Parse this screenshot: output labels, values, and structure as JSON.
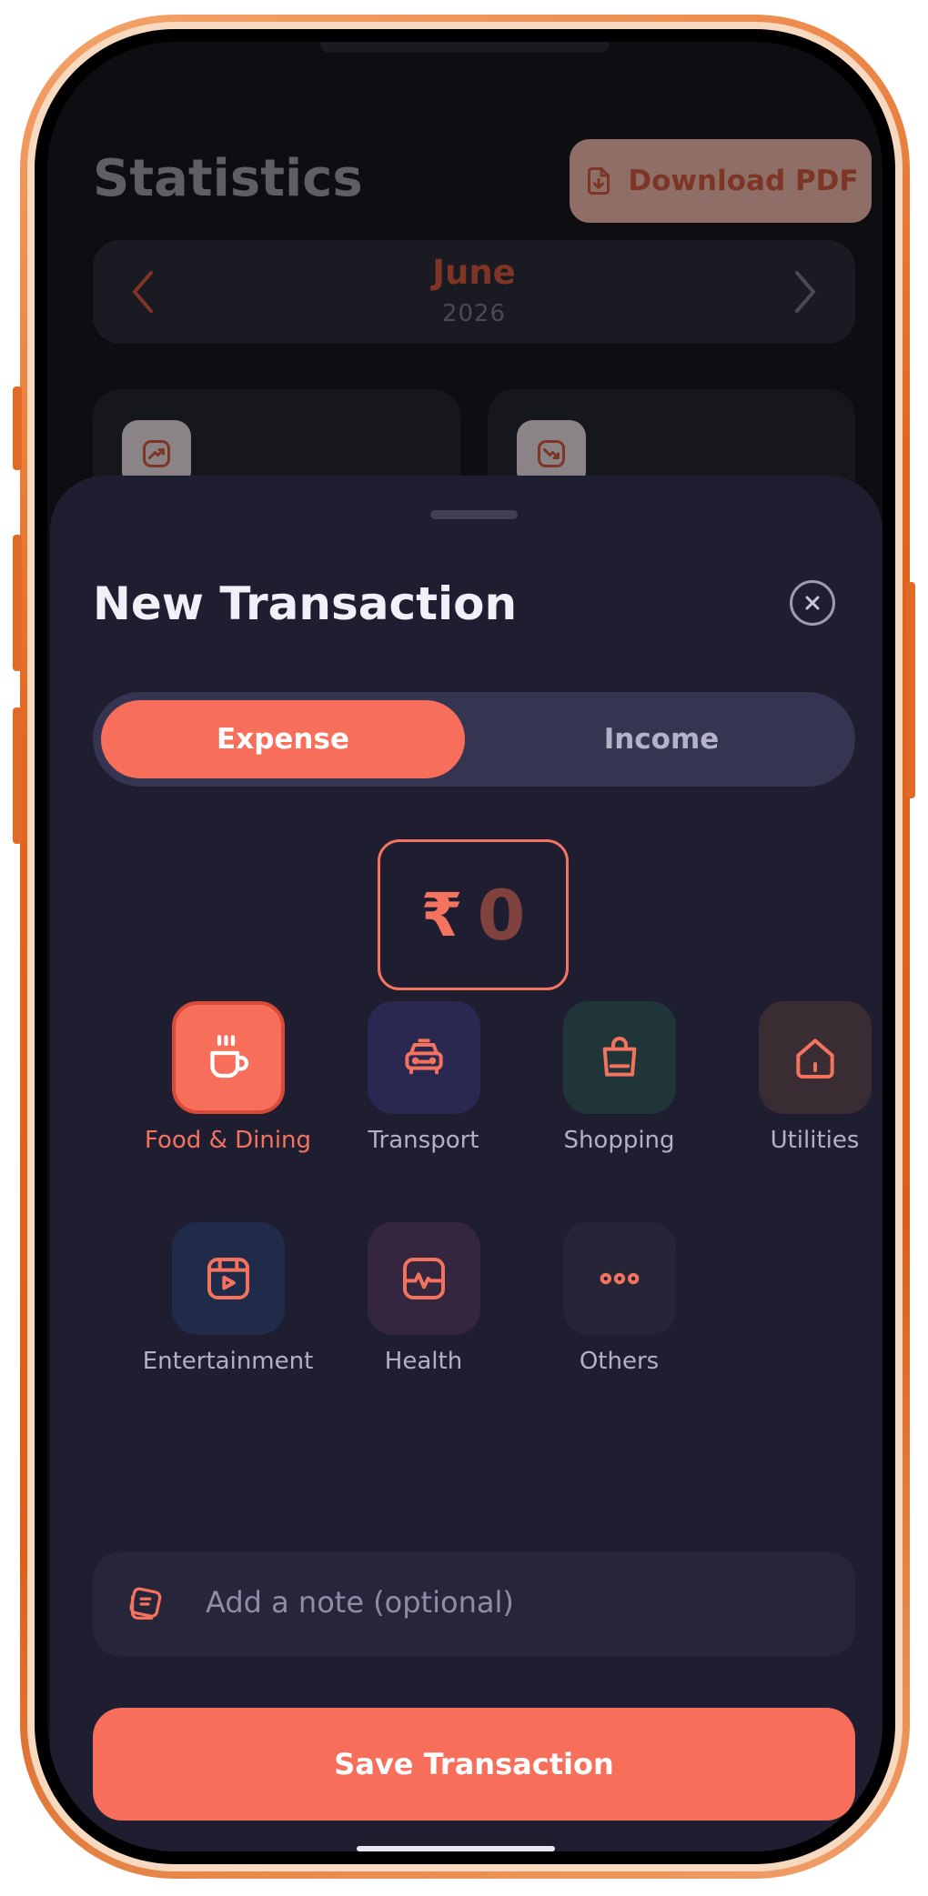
{
  "background": {
    "title": "Statistics",
    "download_label": "Download PDF",
    "month": "June",
    "year": "2026"
  },
  "sheet": {
    "title": "New Transaction",
    "type_toggle": {
      "expense": "Expense",
      "income": "Income",
      "selected": "Expense"
    },
    "amount": {
      "currency": "₹",
      "value": "0"
    },
    "categories": [
      {
        "label": "Food & Dining",
        "icon": "coffee-cup-icon",
        "selected": true,
        "tile_color": "#f76f5b"
      },
      {
        "label": "Transport",
        "icon": "taxi-icon",
        "selected": false,
        "tile_color": "#2a2850"
      },
      {
        "label": "Shopping",
        "icon": "shopping-bag-icon",
        "selected": false,
        "tile_color": "#1f3538"
      },
      {
        "label": "Utilities",
        "icon": "home-icon",
        "selected": false,
        "tile_color": "#3a2c33"
      },
      {
        "label": "Entertainment",
        "icon": "video-play-icon",
        "selected": false,
        "tile_color": "#1f2b48"
      },
      {
        "label": "Health",
        "icon": "health-pulse-icon",
        "selected": false,
        "tile_color": "#352640"
      },
      {
        "label": "Others",
        "icon": "more-dots-icon",
        "selected": false,
        "tile_color": "#262537"
      }
    ],
    "note_placeholder": "Add a note (optional)",
    "save_label": "Save Transaction"
  },
  "colors": {
    "accent": "#f76f5b",
    "sheet_bg": "#1f1e30",
    "frame": "#e0661f"
  }
}
